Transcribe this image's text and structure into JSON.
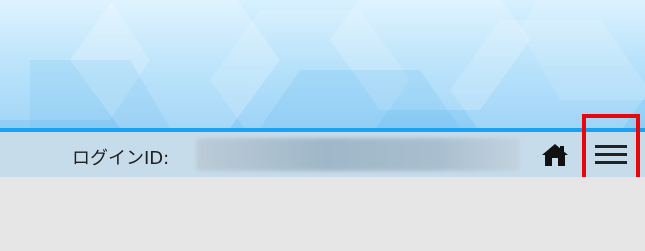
{
  "header": {
    "login_id_label": "ログインID:",
    "login_id_value": ""
  },
  "icons": {
    "home": "home-icon",
    "menu": "hamburger-menu-icon"
  },
  "colors": {
    "accent_line": "#1aa3f2",
    "toolbar_bg": "#c7dceb",
    "highlight_box": "#e8070a",
    "content_bg": "#e6e6e6"
  }
}
